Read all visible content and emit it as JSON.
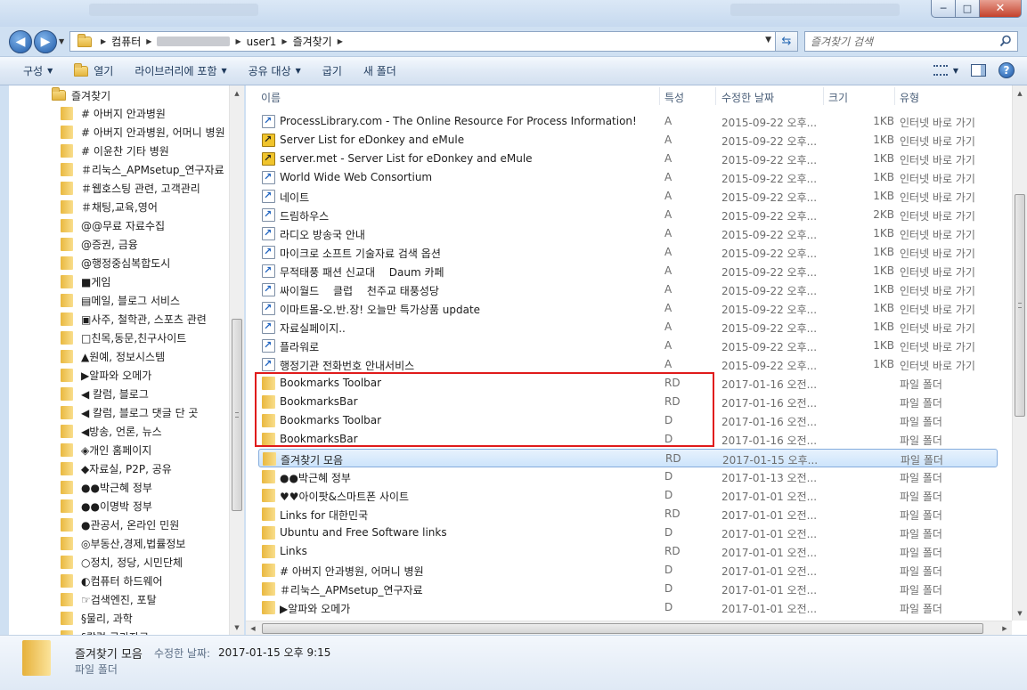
{
  "window": {
    "controls": {
      "minimize": "─",
      "maximize": "□",
      "close": "✕"
    }
  },
  "address": {
    "crumbs": [
      "컴퓨터",
      "(blurred)",
      "user1",
      "즐겨찾기"
    ],
    "search_placeholder": "즐겨찾기 검색"
  },
  "toolbar": {
    "organize": "구성",
    "open": "열기",
    "library": "라이브러리에 포함",
    "share": "공유 대상",
    "burn": "굽기",
    "new_folder": "새 폴더"
  },
  "nav": {
    "header": "즐겨찾기",
    "items": [
      "# 아버지 안과병원",
      "# 아버지 안과병원, 어머니 병원",
      "# 이윤찬 기타 병원",
      "＃리눅스_APMsetup_연구자료",
      "＃웹호스팅 관련, 고객관리",
      "＃채팅,교육,영어",
      "@@무료 자료수집",
      "@증권, 금융",
      "@행정중심복합도시",
      "■게임",
      "▤메일, 블로그 서비스",
      "▣사주, 철학관, 스포츠 관련",
      "□친목,동문,친구사이트",
      "▲원예, 정보시스템",
      "▶알파와 오메가",
      "◀ 칼럼, 블로그",
      "◀ 칼럼, 블로그 댓글 단 곳",
      "◀방송, 언론, 뉴스",
      "◈개인 홈페이지",
      "◆자료실, P2P, 공유",
      "●●박근혜 정부",
      "●●이명박 정부",
      "●관공서, 온라인 민원",
      "◎부동산,경제,법률정보",
      "○정치, 정당, 시민단체",
      "◐컴퓨터 하드웨어",
      "☞검색엔진, 포탈",
      "§물리, 과학",
      "§칼럼 국가자료"
    ]
  },
  "columns": {
    "name": "이름",
    "attr": "특성",
    "date": "수정한 날짜",
    "size": "크기",
    "type": "유형"
  },
  "files": [
    {
      "name": "ProcessLibrary.com - The Online Resource For Process Information!",
      "attr": "A",
      "date": "2015-09-22 오후...",
      "size": "1KB",
      "type": "인터넷 바로 가기",
      "icon": "url"
    },
    {
      "name": "Server List for eDonkey and eMule",
      "attr": "A",
      "date": "2015-09-22 오후...",
      "size": "1KB",
      "type": "인터넷 바로 가기",
      "icon": "mule"
    },
    {
      "name": "server.met - Server List for eDonkey and eMule",
      "attr": "A",
      "date": "2015-09-22 오후...",
      "size": "1KB",
      "type": "인터넷 바로 가기",
      "icon": "mule"
    },
    {
      "name": "World Wide Web Consortium",
      "attr": "A",
      "date": "2015-09-22 오후...",
      "size": "1KB",
      "type": "인터넷 바로 가기",
      "icon": "url"
    },
    {
      "name": "네이트",
      "attr": "A",
      "date": "2015-09-22 오후...",
      "size": "1KB",
      "type": "인터넷 바로 가기",
      "icon": "url"
    },
    {
      "name": "드림하우스",
      "attr": "A",
      "date": "2015-09-22 오후...",
      "size": "2KB",
      "type": "인터넷 바로 가기",
      "icon": "url"
    },
    {
      "name": "라디오 방송국 안내",
      "attr": "A",
      "date": "2015-09-22 오후...",
      "size": "1KB",
      "type": "인터넷 바로 가기",
      "icon": "url"
    },
    {
      "name": "마이크로 소프트 기술자료 검색 옵션",
      "attr": "A",
      "date": "2015-09-22 오후...",
      "size": "1KB",
      "type": "인터넷 바로 가기",
      "icon": "url"
    },
    {
      "name": "무적태풍 패션 신교대 　Daum 카페",
      "attr": "A",
      "date": "2015-09-22 오후...",
      "size": "1KB",
      "type": "인터넷 바로 가기",
      "icon": "url"
    },
    {
      "name": "싸이월드 　클럽 　천주교 태풍성당",
      "attr": "A",
      "date": "2015-09-22 오후...",
      "size": "1KB",
      "type": "인터넷 바로 가기",
      "icon": "url"
    },
    {
      "name": "이마트몰-오.반.장! 오늘만 특가상품 update",
      "attr": "A",
      "date": "2015-09-22 오후...",
      "size": "1KB",
      "type": "인터넷 바로 가기",
      "icon": "url"
    },
    {
      "name": "자료실페이지..",
      "attr": "A",
      "date": "2015-09-22 오후...",
      "size": "1KB",
      "type": "인터넷 바로 가기",
      "icon": "url"
    },
    {
      "name": "플라워로",
      "attr": "A",
      "date": "2015-09-22 오후...",
      "size": "1KB",
      "type": "인터넷 바로 가기",
      "icon": "url"
    },
    {
      "name": "행정기관 전화번호 안내서비스",
      "attr": "A",
      "date": "2015-09-22 오후...",
      "size": "1KB",
      "type": "인터넷 바로 가기",
      "icon": "url"
    },
    {
      "name": "Bookmarks Toolbar",
      "attr": "RD",
      "date": "2017-01-16 오전...",
      "size": "",
      "type": "파일 폴더",
      "icon": "folder"
    },
    {
      "name": "BookmarksBar",
      "attr": "RD",
      "date": "2017-01-16 오전...",
      "size": "",
      "type": "파일 폴더",
      "icon": "folder"
    },
    {
      "name": "Bookmarks Toolbar",
      "attr": "D",
      "date": "2017-01-16 오전...",
      "size": "",
      "type": "파일 폴더",
      "icon": "folder"
    },
    {
      "name": "BookmarksBar",
      "attr": "D",
      "date": "2017-01-16 오전...",
      "size": "",
      "type": "파일 폴더",
      "icon": "folder"
    },
    {
      "name": "즐겨찾기 모음",
      "attr": "RD",
      "date": "2017-01-15 오후...",
      "size": "",
      "type": "파일 폴더",
      "icon": "folder",
      "selected": true
    },
    {
      "name": "●●박근혜 정부",
      "attr": "D",
      "date": "2017-01-13 오전...",
      "size": "",
      "type": "파일 폴더",
      "icon": "folder"
    },
    {
      "name": "♥♥아이팟&스마트폰 사이트",
      "attr": "D",
      "date": "2017-01-01 오전...",
      "size": "",
      "type": "파일 폴더",
      "icon": "folder"
    },
    {
      "name": "Links for 대한민국",
      "attr": "RD",
      "date": "2017-01-01 오전...",
      "size": "",
      "type": "파일 폴더",
      "icon": "folder"
    },
    {
      "name": "Ubuntu and Free Software links",
      "attr": "D",
      "date": "2017-01-01 오전...",
      "size": "",
      "type": "파일 폴더",
      "icon": "folder"
    },
    {
      "name": "Links",
      "attr": "RD",
      "date": "2017-01-01 오전...",
      "size": "",
      "type": "파일 폴더",
      "icon": "folder"
    },
    {
      "name": "# 아버지 안과병원, 어머니 병원",
      "attr": "D",
      "date": "2017-01-01 오전...",
      "size": "",
      "type": "파일 폴더",
      "icon": "folder"
    },
    {
      "name": "＃리눅스_APMsetup_연구자료",
      "attr": "D",
      "date": "2017-01-01 오전...",
      "size": "",
      "type": "파일 폴더",
      "icon": "folder"
    },
    {
      "name": "▶알파와 오메가",
      "attr": "D",
      "date": "2017-01-01 오전...",
      "size": "",
      "type": "파일 폴더",
      "icon": "folder"
    }
  ],
  "details": {
    "name": "즐겨찾기 모음",
    "date_label": "수정한 날짜:",
    "date": "2017-01-15 오후 9:15",
    "type": "파일 폴더"
  }
}
